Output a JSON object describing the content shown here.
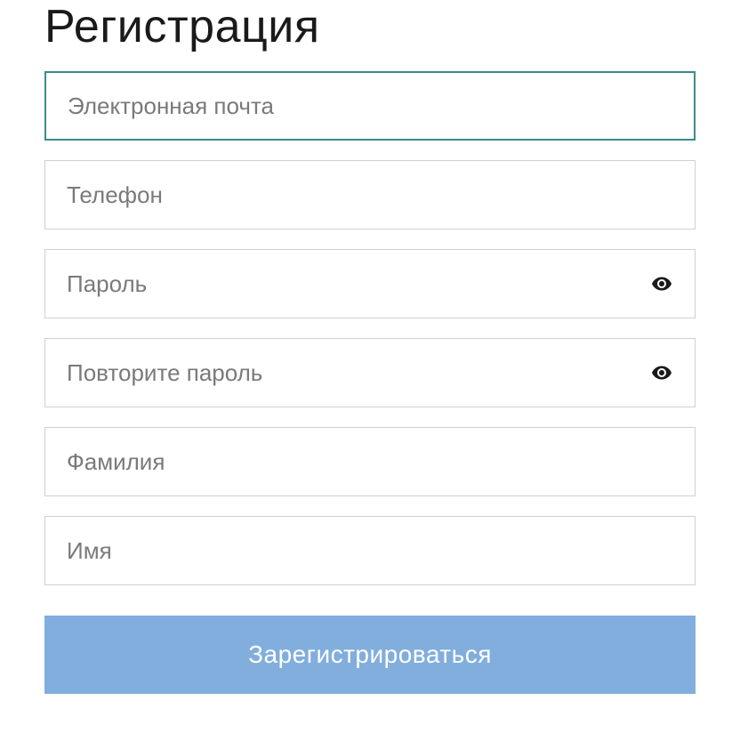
{
  "form": {
    "title": "Регистрация",
    "fields": {
      "email": {
        "placeholder": "Электронная почта",
        "value": ""
      },
      "phone": {
        "placeholder": "Телефон",
        "value": ""
      },
      "password": {
        "placeholder": "Пароль",
        "value": ""
      },
      "password_confirm": {
        "placeholder": "Повторите пароль",
        "value": ""
      },
      "lastname": {
        "placeholder": "Фамилия",
        "value": ""
      },
      "firstname": {
        "placeholder": "Имя",
        "value": ""
      }
    },
    "submit_label": "Зарегистрироваться"
  }
}
